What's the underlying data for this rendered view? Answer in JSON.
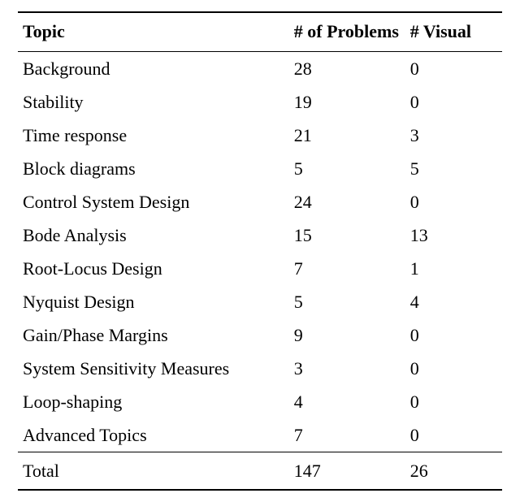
{
  "table": {
    "headers": {
      "topic": "Topic",
      "problems": "# of Problems",
      "visual": "# Visual"
    },
    "rows": [
      {
        "topic": "Background",
        "problems": "28",
        "visual": "0"
      },
      {
        "topic": "Stability",
        "problems": "19",
        "visual": "0"
      },
      {
        "topic": "Time response",
        "problems": "21",
        "visual": "3"
      },
      {
        "topic": "Block diagrams",
        "problems": "5",
        "visual": "5"
      },
      {
        "topic": "Control System Design",
        "problems": "24",
        "visual": "0"
      },
      {
        "topic": "Bode Analysis",
        "problems": "15",
        "visual": "13"
      },
      {
        "topic": "Root-Locus Design",
        "problems": "7",
        "visual": "1"
      },
      {
        "topic": "Nyquist Design",
        "problems": "5",
        "visual": "4"
      },
      {
        "topic": "Gain/Phase Margins",
        "problems": "9",
        "visual": "0"
      },
      {
        "topic": "System Sensitivity Measures",
        "problems": "3",
        "visual": "0"
      },
      {
        "topic": "Loop-shaping",
        "problems": "4",
        "visual": "0"
      },
      {
        "topic": "Advanced Topics",
        "problems": "7",
        "visual": "0"
      }
    ],
    "total": {
      "label": "Total",
      "problems": "147",
      "visual": "26"
    }
  }
}
